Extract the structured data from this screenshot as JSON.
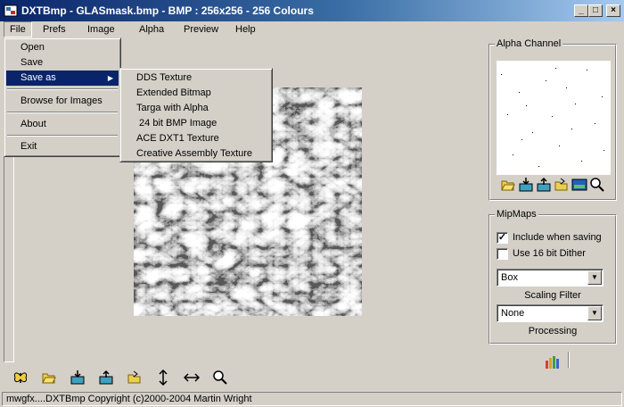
{
  "window": {
    "title": "DXTBmp - GLASmask.bmp - BMP : 256x256 - 256 Colours",
    "minimize": "_",
    "maximize": "□",
    "close": "×"
  },
  "menubar": [
    "File",
    "Prefs",
    "Image",
    "Alpha",
    "Preview",
    "Help"
  ],
  "file_menu": {
    "items": [
      "Open",
      "Save",
      "Save as",
      "Browse for Images",
      "About",
      "Exit"
    ],
    "highlighted": "Save as",
    "submenu_arrow": "▶"
  },
  "save_as_menu": {
    "items": [
      "DDS Texture",
      "Extended Bitmap",
      "Targa with Alpha",
      " 24 bit BMP Image",
      "ACE DXT1 Texture",
      "Creative Assembly Texture"
    ]
  },
  "alpha_channel": {
    "label": "Alpha Channel",
    "icons": [
      "open-folder-icon",
      "import-icon",
      "export-icon",
      "browse-folder-icon",
      "view-image-icon",
      "zoom-icon"
    ]
  },
  "mipmaps": {
    "label": "MipMaps",
    "include_when_saving": {
      "label": "Include when saving",
      "checked": true,
      "mark": "✓"
    },
    "use_16bit_dither": {
      "label": "Use 16 bit Dither",
      "checked": false
    },
    "scaling_filter": {
      "value": "Box",
      "caption": "Scaling Filter"
    },
    "processing": {
      "value": "None",
      "caption": "Processing"
    },
    "drop_arrow": "▼"
  },
  "bottom_toolbar": {
    "icons": [
      "butterfly-icon",
      "open-folder-icon",
      "import-icon",
      "export-icon",
      "browse-folder-icon",
      "flip-vertical-icon",
      "flip-horizontal-icon",
      "zoom-icon"
    ]
  },
  "status": {
    "text": "mwgfx....DXTBmp Copyright (c)2000-2004 Martin Wright"
  },
  "colors": {
    "titlebar_start": "#0a246a",
    "titlebar_end": "#a6caf0",
    "face": "#d4d0c8",
    "highlight": "#0a246a"
  }
}
